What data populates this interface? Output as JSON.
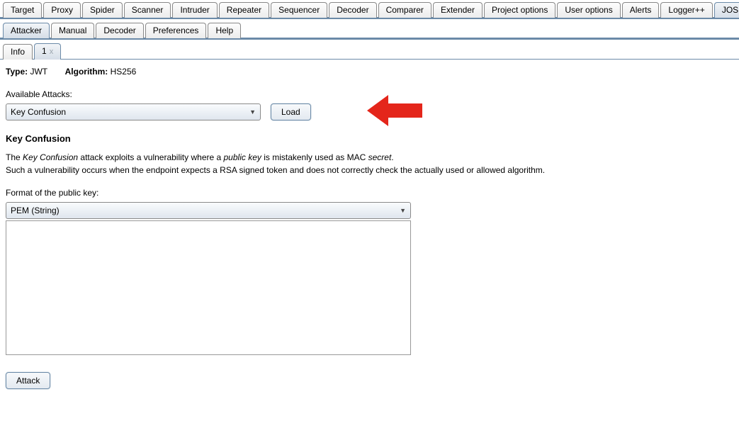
{
  "topTabs": {
    "items": [
      {
        "label": "Target"
      },
      {
        "label": "Proxy"
      },
      {
        "label": "Spider"
      },
      {
        "label": "Scanner"
      },
      {
        "label": "Intruder"
      },
      {
        "label": "Repeater"
      },
      {
        "label": "Sequencer"
      },
      {
        "label": "Decoder"
      },
      {
        "label": "Comparer"
      },
      {
        "label": "Extender"
      },
      {
        "label": "Project options"
      },
      {
        "label": "User options"
      },
      {
        "label": "Alerts"
      },
      {
        "label": "Logger++"
      },
      {
        "label": "JOSEPH",
        "active": true
      }
    ]
  },
  "subTabs": {
    "items": [
      {
        "label": "Attacker",
        "active": true
      },
      {
        "label": "Manual"
      },
      {
        "label": "Decoder"
      },
      {
        "label": "Preferences"
      },
      {
        "label": "Help"
      }
    ]
  },
  "sessionTabs": {
    "items": [
      {
        "label": "Info"
      },
      {
        "label": "1",
        "active": true,
        "closable": true
      }
    ]
  },
  "meta": {
    "typeLabel": "Type:",
    "typeValue": "JWT",
    "algoLabel": "Algorithm:",
    "algoValue": "HS256"
  },
  "attacks": {
    "label": "Available Attacks:",
    "selected": "Key Confusion",
    "loadBtn": "Load"
  },
  "attackInfo": {
    "title": "Key Confusion",
    "desc_part1": "The ",
    "desc_em1": "Key Confusion",
    "desc_part2": " attack exploits a vulnerability where a ",
    "desc_em2": "public key",
    "desc_part3": " is mistakenly used as MAC ",
    "desc_em3": "secret",
    "desc_part4": ".",
    "desc_line2": "Such a vulnerability occurs when the endpoint expects a RSA signed token and does not correctly check the actually used or allowed algorithm."
  },
  "format": {
    "label": "Format of the public key:",
    "selected": "PEM (String)"
  },
  "keyInput": {
    "value": ""
  },
  "attackBtn": "Attack",
  "annotation": {
    "arrow": "red-arrow-left"
  }
}
